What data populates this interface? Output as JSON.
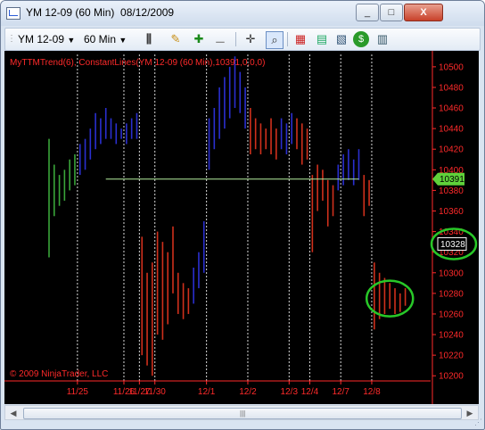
{
  "window": {
    "title": "YM 12-09 (60 Min)  08/12/2009",
    "minimize_label": "_",
    "maximize_label": "□",
    "close_label": "X"
  },
  "toolbar": {
    "instrument": "YM 12-09",
    "interval": "60 Min",
    "icons": [
      "bar-style-icon",
      "draw-pencil-icon",
      "zoom-in-icon",
      "zoom-out-icon",
      "crosshair-icon",
      "zoom-box-icon",
      "data-box-icon",
      "chart-properties-icon",
      "strategy-icon",
      "order-entry-icon"
    ]
  },
  "chart": {
    "indicator_label": "MyTTMTrend(6), ConstantLines(YM 12-09 (60 Min),10391,0,0,0)",
    "copyright": "© 2009 NinjaTrader, LLC",
    "constant_line_label": "10391",
    "last_price_label": "10328",
    "colors": {
      "background": "#000000",
      "up": "#2a2fd0",
      "down": "#d0301c",
      "neutral": "#3aa63a",
      "axis_text": "#ff2a2a",
      "constant_line": "#b6f0a0",
      "highlight_circle": "#28c828",
      "session_line": "#d8d8d8"
    }
  },
  "chart_data": {
    "type": "bar",
    "y_ticks": [
      "10500",
      "10480",
      "10460",
      "10440",
      "10420",
      "10400",
      "10380",
      "10360",
      "10340",
      "10320",
      "10300",
      "10280",
      "10260",
      "10240",
      "10220",
      "10200"
    ],
    "x_ticks": [
      "11/25",
      "11/26",
      "11/27",
      "11/30",
      "12/1",
      "12/2",
      "12/3",
      "12/4",
      "12/7",
      "12/8"
    ],
    "ylim": [
      10195,
      10512
    ],
    "constant_line": 10391,
    "last_price": 10328,
    "session_dividers": [
      0,
      1,
      2,
      3,
      4,
      5,
      6,
      7,
      8,
      9
    ],
    "bars": [
      {
        "h": 10430,
        "l": 10315,
        "c": "g"
      },
      {
        "h": 10405,
        "l": 10355,
        "c": "g"
      },
      {
        "h": 10395,
        "l": 10365,
        "c": "g"
      },
      {
        "h": 10400,
        "l": 10370,
        "c": "g"
      },
      {
        "h": 10410,
        "l": 10380,
        "c": "g"
      },
      {
        "h": 10415,
        "l": 10385,
        "c": "g"
      },
      {
        "h": 10425,
        "l": 10395,
        "c": "b"
      },
      {
        "h": 10430,
        "l": 10400,
        "c": "b"
      },
      {
        "h": 10440,
        "l": 10410,
        "c": "b"
      },
      {
        "h": 10455,
        "l": 10420,
        "c": "b"
      },
      {
        "h": 10450,
        "l": 10425,
        "c": "b"
      },
      {
        "h": 10460,
        "l": 10430,
        "c": "b"
      },
      {
        "h": 10450,
        "l": 10430,
        "c": "b"
      },
      {
        "h": 10445,
        "l": 10425,
        "c": "b"
      },
      {
        "h": 10440,
        "l": 10430,
        "c": "b"
      },
      {
        "h": 10445,
        "l": 10425,
        "c": "b"
      },
      {
        "h": 10450,
        "l": 10430,
        "c": "b"
      },
      {
        "h": 10455,
        "l": 10430,
        "c": "b"
      },
      {
        "h": 10335,
        "l": 10220,
        "c": "r"
      },
      {
        "h": 10300,
        "l": 10210,
        "c": "r"
      },
      {
        "h": 10310,
        "l": 10200,
        "c": "r"
      },
      {
        "h": 10340,
        "l": 10240,
        "c": "r"
      },
      {
        "h": 10330,
        "l": 10235,
        "c": "r"
      },
      {
        "h": 10320,
        "l": 10250,
        "c": "r"
      },
      {
        "h": 10345,
        "l": 10280,
        "c": "r"
      },
      {
        "h": 10300,
        "l": 10260,
        "c": "r"
      },
      {
        "h": 10290,
        "l": 10255,
        "c": "r"
      },
      {
        "h": 10285,
        "l": 10260,
        "c": "r"
      },
      {
        "h": 10305,
        "l": 10270,
        "c": "b"
      },
      {
        "h": 10320,
        "l": 10285,
        "c": "b"
      },
      {
        "h": 10350,
        "l": 10300,
        "c": "b"
      },
      {
        "h": 10450,
        "l": 10400,
        "c": "b"
      },
      {
        "h": 10460,
        "l": 10420,
        "c": "b"
      },
      {
        "h": 10480,
        "l": 10430,
        "c": "b"
      },
      {
        "h": 10490,
        "l": 10440,
        "c": "b"
      },
      {
        "h": 10500,
        "l": 10450,
        "c": "b"
      },
      {
        "h": 10510,
        "l": 10460,
        "c": "b"
      },
      {
        "h": 10495,
        "l": 10455,
        "c": "b"
      },
      {
        "h": 10480,
        "l": 10440,
        "c": "b"
      },
      {
        "h": 10460,
        "l": 10415,
        "c": "r"
      },
      {
        "h": 10450,
        "l": 10420,
        "c": "r"
      },
      {
        "h": 10445,
        "l": 10415,
        "c": "r"
      },
      {
        "h": 10440,
        "l": 10420,
        "c": "r"
      },
      {
        "h": 10450,
        "l": 10415,
        "c": "r"
      },
      {
        "h": 10440,
        "l": 10410,
        "c": "r"
      },
      {
        "h": 10450,
        "l": 10420,
        "c": "b"
      },
      {
        "h": 10445,
        "l": 10415,
        "c": "b"
      },
      {
        "h": 10455,
        "l": 10425,
        "c": "b"
      },
      {
        "h": 10450,
        "l": 10420,
        "c": "r"
      },
      {
        "h": 10445,
        "l": 10405,
        "c": "r"
      },
      {
        "h": 10440,
        "l": 10410,
        "c": "r"
      },
      {
        "h": 10395,
        "l": 10320,
        "c": "r"
      },
      {
        "h": 10405,
        "l": 10360,
        "c": "r"
      },
      {
        "h": 10400,
        "l": 10370,
        "c": "r"
      },
      {
        "h": 10390,
        "l": 10345,
        "c": "r"
      },
      {
        "h": 10385,
        "l": 10355,
        "c": "r"
      },
      {
        "h": 10405,
        "l": 10380,
        "c": "b"
      },
      {
        "h": 10415,
        "l": 10385,
        "c": "b"
      },
      {
        "h": 10420,
        "l": 10390,
        "c": "b"
      },
      {
        "h": 10410,
        "l": 10385,
        "c": "b"
      },
      {
        "h": 10420,
        "l": 10390,
        "c": "b"
      },
      {
        "h": 10395,
        "l": 10355,
        "c": "r"
      },
      {
        "h": 10390,
        "l": 10365,
        "c": "r"
      },
      {
        "h": 10310,
        "l": 10245,
        "c": "r"
      },
      {
        "h": 10300,
        "l": 10255,
        "c": "r"
      },
      {
        "h": 10295,
        "l": 10260,
        "c": "r"
      },
      {
        "h": 10290,
        "l": 10265,
        "c": "r"
      },
      {
        "h": 10285,
        "l": 10260,
        "c": "r"
      },
      {
        "h": 10280,
        "l": 10262,
        "c": "r"
      },
      {
        "h": 10285,
        "l": 10268,
        "c": "r"
      }
    ]
  }
}
